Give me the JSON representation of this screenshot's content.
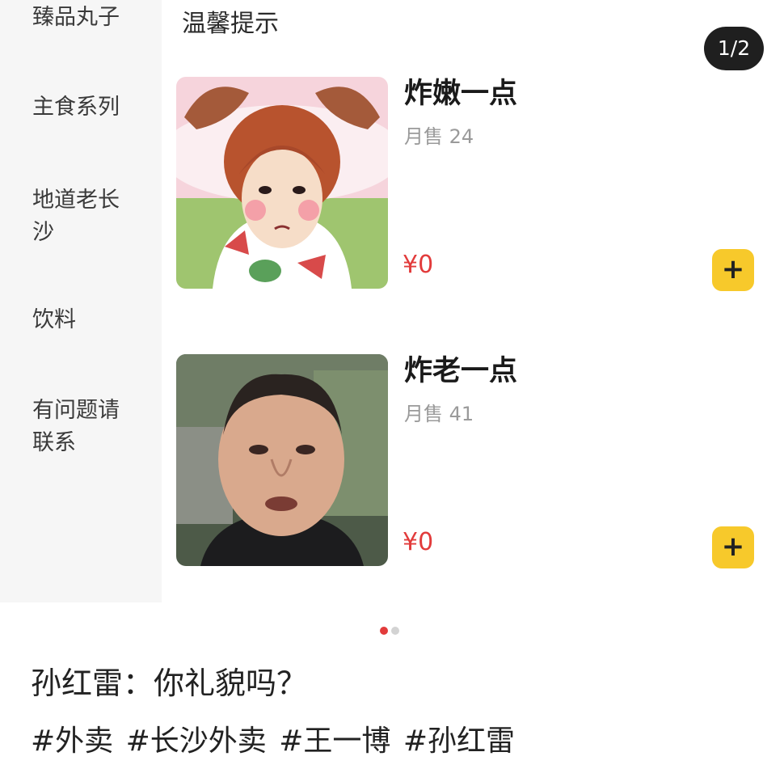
{
  "sidebar": {
    "items": [
      {
        "label": "臻品丸子"
      },
      {
        "label": "主食系列"
      },
      {
        "label_line1": "地道老长",
        "label_line2": "沙"
      },
      {
        "label": "饮料"
      },
      {
        "label_line1": "有问题请",
        "label_line2": "联系"
      }
    ]
  },
  "section": {
    "title": "温馨提示"
  },
  "pager": {
    "text": "1/2"
  },
  "items": [
    {
      "name": "炸嫩一点",
      "sales": "月售 24",
      "price": "¥0",
      "add": "+"
    },
    {
      "name": "炸老一点",
      "sales": "月售 41",
      "price": "¥0",
      "add": "+"
    }
  ],
  "carousel": {
    "active_index": 0,
    "count": 2
  },
  "caption": "孙红雷：你礼貌吗？",
  "tags": [
    "#外卖",
    "#长沙外卖",
    "#王一博",
    "#孙红雷"
  ],
  "colors": {
    "price": "#e23b3b",
    "add_button": "#f7c92b",
    "sidebar_bg": "#f6f6f6"
  }
}
